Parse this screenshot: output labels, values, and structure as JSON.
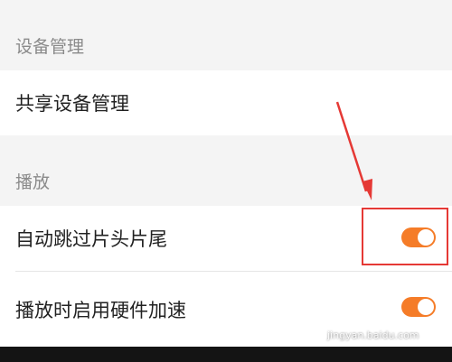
{
  "sections": [
    {
      "header": "设备管理",
      "items": [
        {
          "label": "共享设备管理"
        }
      ]
    },
    {
      "header": "播放",
      "items": [
        {
          "label": "自动跳过片头片尾",
          "toggle_on": true
        },
        {
          "label": "播放时启用硬件加速",
          "toggle_on": true
        }
      ]
    }
  ],
  "colors": {
    "toggle_on": "#f57c28",
    "annotation": "#e53935"
  },
  "watermark": "jingyan.baidu.com"
}
